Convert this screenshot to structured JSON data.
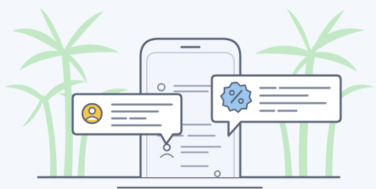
{
  "illustration": {
    "palm_icon": "palm-tree-icon",
    "phone_icon": "smartphone-icon",
    "user_icon": "user-avatar-icon",
    "discount_icon": "discount-badge-icon"
  },
  "colors": {
    "background": "#f4f7fc",
    "palm": "#c3e8c5",
    "outline": "#5a6578",
    "line": "#7d8899",
    "phone_fill": "#f2f5fb",
    "bubble_fill": "#ffffff",
    "user_badge": "#f7c64a",
    "discount_badge": "#9cc6ee"
  }
}
